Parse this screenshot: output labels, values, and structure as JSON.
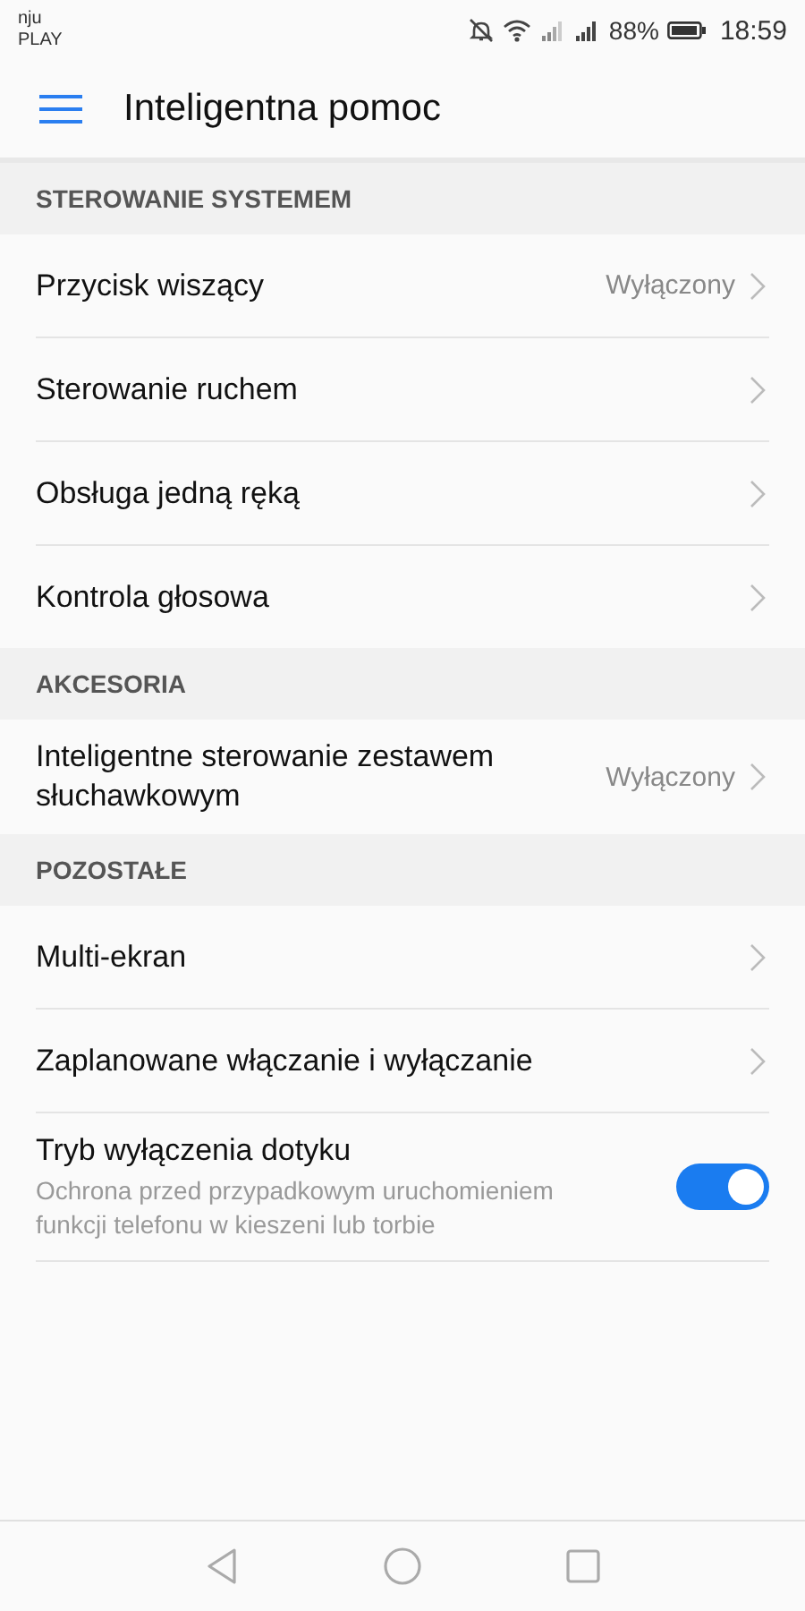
{
  "status_bar": {
    "carrier": [
      "nju",
      "PLAY"
    ],
    "battery": "88%",
    "time": "18:59"
  },
  "app_bar": {
    "title": "Inteligentna pomoc"
  },
  "sections": [
    {
      "header": "STEROWANIE SYSTEMEM",
      "items": [
        {
          "kind": "link",
          "label": "Przycisk wiszący",
          "value": "Wyłączony"
        },
        {
          "kind": "link",
          "label": "Sterowanie ruchem"
        },
        {
          "kind": "link",
          "label": "Obsługa jedną ręką"
        },
        {
          "kind": "link",
          "label": "Kontrola głosowa"
        }
      ]
    },
    {
      "header": "AKCESORIA",
      "items": [
        {
          "kind": "link",
          "label": "Inteligentne sterowanie zestawem słuchawkowym",
          "value": "Wyłączony"
        }
      ]
    },
    {
      "header": "POZOSTAŁE",
      "items": [
        {
          "kind": "link",
          "label": "Multi-ekran"
        },
        {
          "kind": "link",
          "label": "Zaplanowane włączanie i wyłączanie"
        },
        {
          "kind": "toggle",
          "label": "Tryb wyłączenia dotyku",
          "description": "Ochrona przed przypadkowym uruchomieniem funkcji telefonu w kieszeni lub torbie",
          "on": true
        }
      ]
    }
  ]
}
